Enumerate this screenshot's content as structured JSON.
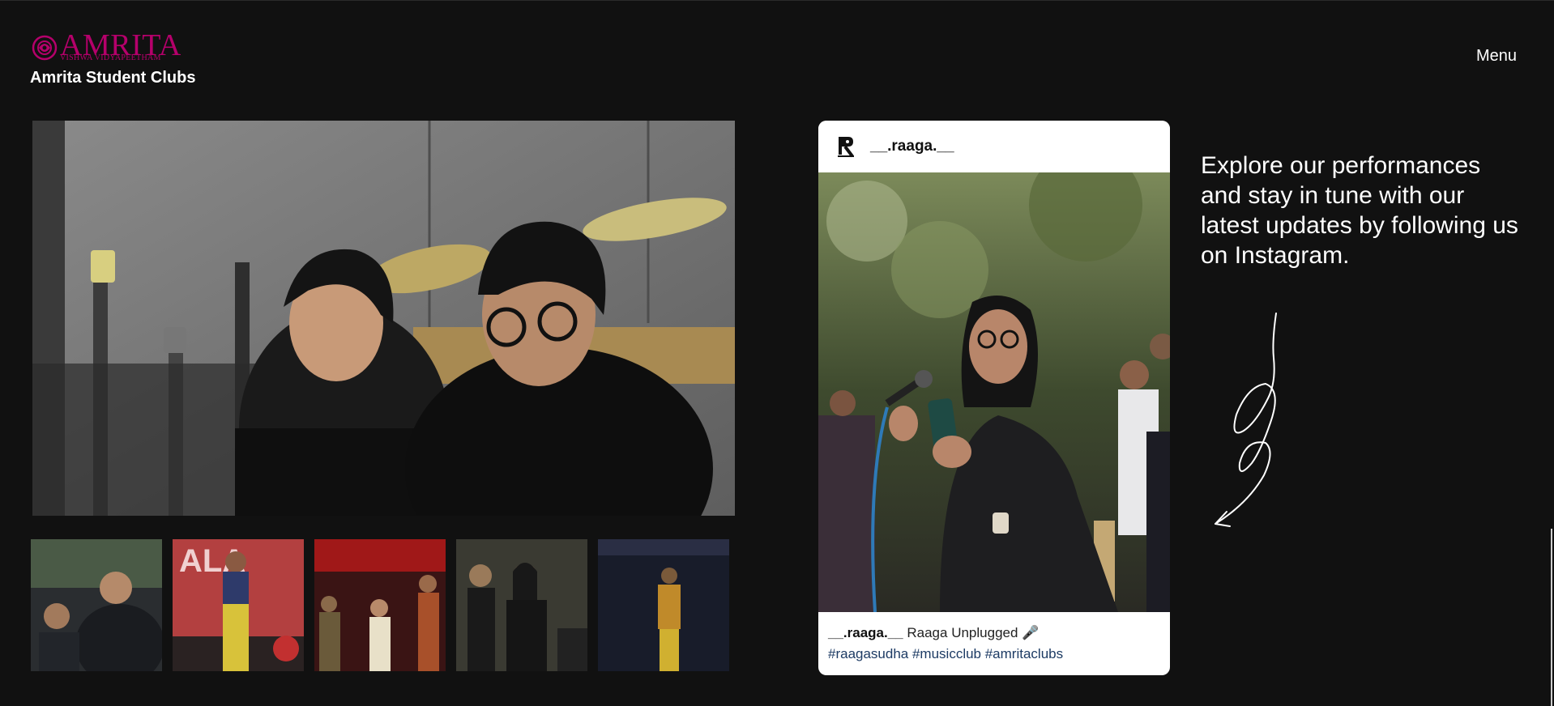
{
  "header": {
    "logo_word": "AMRITA",
    "logo_sub": "VISHWA VIDYAPEETHAM",
    "site_title": "Amrita Student Clubs",
    "menu_label": "Menu",
    "brand_color": "#b5006b"
  },
  "instagram_post": {
    "username": "__.raaga.__",
    "caption_user": "__.raaga.__",
    "caption_text": "Raaga Unplugged 🎤",
    "hashtags": "#raagasudha #musicclub #amritaclubs"
  },
  "cta": {
    "text": "Explore our performances and stay in tune with our latest updates by following us on Instagram."
  },
  "icons": [
    "amrita-logo-icon",
    "raaga-logo-icon",
    "arrow-doodle-icon"
  ]
}
